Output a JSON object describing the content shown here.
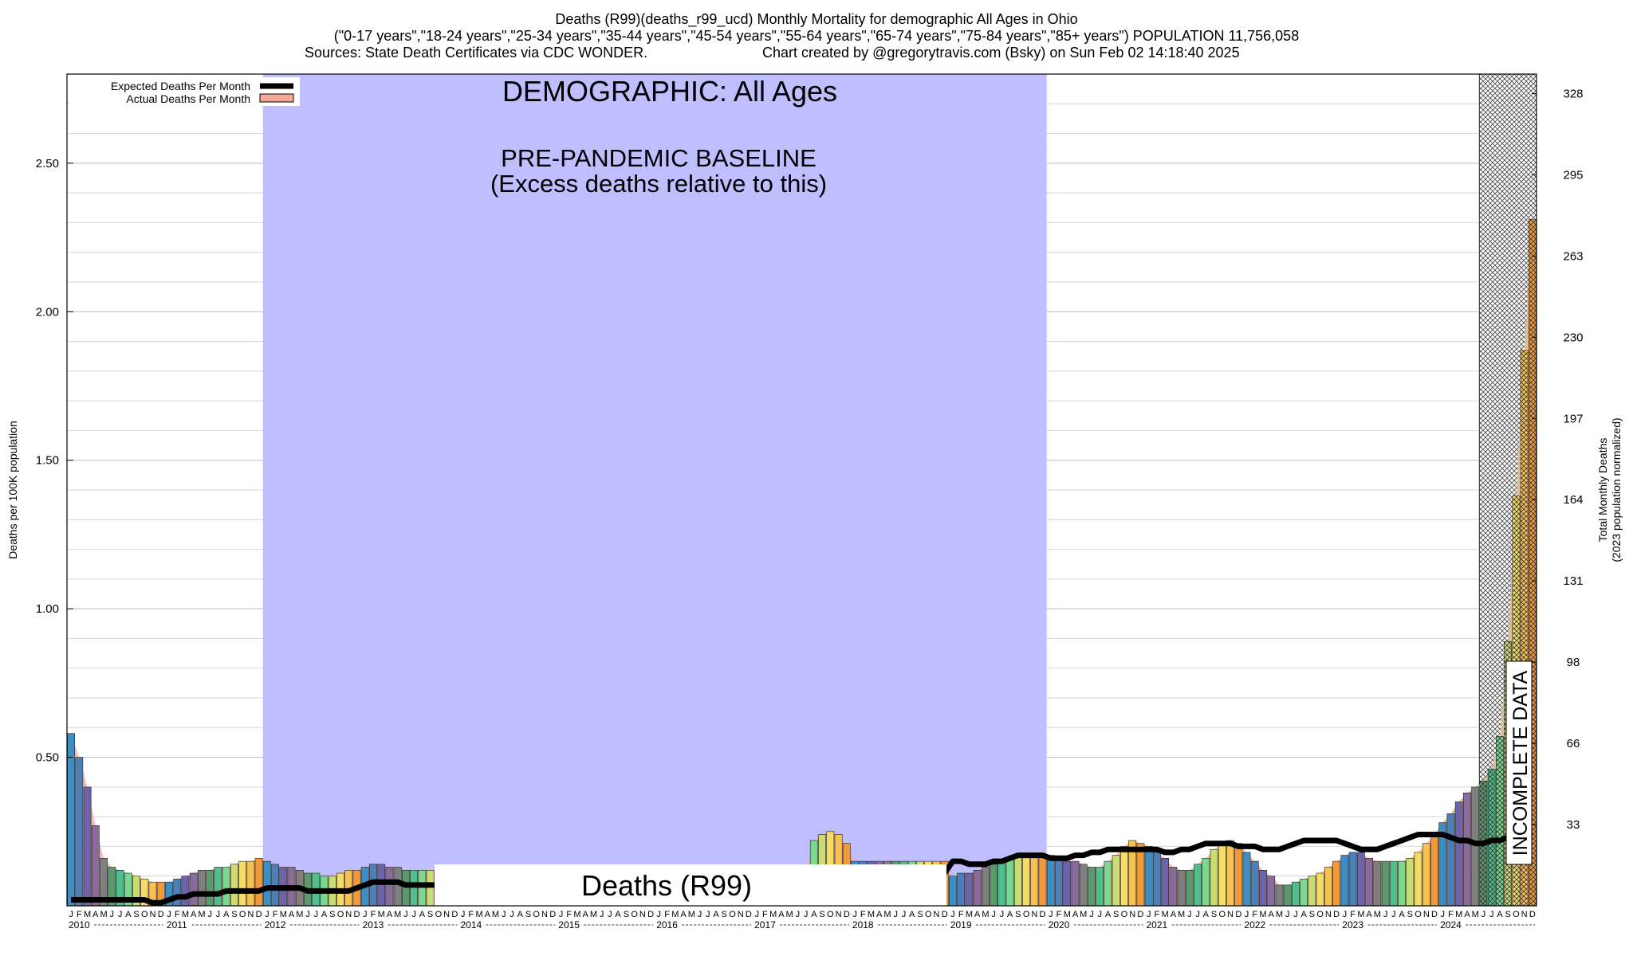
{
  "chart_data": {
    "type": "bar",
    "title_lines": [
      "Deaths (R99)(deaths_r99_ucd) Monthly Mortality for demographic All Ages in Ohio",
      "(\"0-17 years\",\"18-24 years\",\"25-34 years\",\"35-44 years\",\"45-54 years\",\"55-64 years\",\"65-74 years\",\"75-84 years\",\"85+ years\") POPULATION 11,756,058",
      "Sources: State Death Certificates via CDC WONDER.",
      "Chart created by @gregorytravis.com (Bsky) on Sun Feb 02 14:18:40 2025"
    ],
    "ylabel": "Deaths per 100K population",
    "y2label_lines": [
      "Total Monthly Deaths",
      "(2023 population normalized)"
    ],
    "ylim": [
      0,
      2.8
    ],
    "yticks": [
      "0.50",
      "1.00",
      "1.50",
      "2.00",
      "2.50"
    ],
    "y2ticks": [
      "33",
      "66",
      "98",
      "131",
      "164",
      "197",
      "230",
      "263",
      "295",
      "328"
    ],
    "years": [
      "2010",
      "2011",
      "2012",
      "2013",
      "2014",
      "2015",
      "2016",
      "2017",
      "2018",
      "2019",
      "2020",
      "2021",
      "2022",
      "2023",
      "2024"
    ],
    "month_letters": [
      "J",
      "F",
      "M",
      "A",
      "M",
      "J",
      "J",
      "A",
      "S",
      "O",
      "N",
      "D"
    ],
    "legend": [
      {
        "label": "Expected Deaths Per Month",
        "color": "#000000"
      },
      {
        "label": "Actual Deaths Per Month",
        "color": "#f4a99a"
      }
    ],
    "baseline_box": {
      "x_start": "2012-01",
      "x_end": "2019-12",
      "heading": "DEMOGRAPHIC: All Ages",
      "caption_lines": [
        "PRE-PANDEMIC BASELINE",
        "(Excess deaths relative to this)"
      ],
      "color": "#bfbfff"
    },
    "bottom_label": "Deaths (R99)",
    "incomplete": {
      "x_start": "2024-06",
      "label": "INCOMPLETE DATA"
    },
    "series": [
      {
        "name": "Actual Deaths Per Month",
        "values": [
          0.58,
          0.5,
          0.4,
          0.27,
          0.16,
          0.13,
          0.12,
          0.11,
          0.1,
          0.09,
          0.08,
          0.08,
          0.08,
          0.09,
          0.1,
          0.11,
          0.12,
          0.12,
          0.13,
          0.13,
          0.14,
          0.15,
          0.15,
          0.16,
          0.15,
          0.14,
          0.13,
          0.13,
          0.12,
          0.11,
          0.11,
          0.1,
          0.1,
          0.11,
          0.12,
          0.12,
          0.13,
          0.14,
          0.14,
          0.13,
          0.13,
          0.12,
          0.12,
          0.12,
          0.12,
          0.12,
          0.12,
          0.12,
          0.12,
          0.12,
          0.12,
          0.12,
          0.12,
          0.12,
          0.12,
          0.12,
          0.12,
          0.12,
          0.12,
          0.12,
          0.12,
          0.12,
          0.12,
          0.12,
          0.12,
          0.12,
          0.12,
          0.12,
          0.12,
          0.12,
          0.12,
          0.12,
          0.12,
          0.12,
          0.12,
          0.12,
          0.12,
          0.12,
          0.12,
          0.12,
          0.12,
          0.12,
          0.12,
          0.12,
          0.12,
          0.12,
          0.12,
          0.12,
          0.12,
          0.12,
          0.12,
          0.22,
          0.24,
          0.25,
          0.24,
          0.21,
          0.15,
          0.15,
          0.15,
          0.15,
          0.15,
          0.15,
          0.15,
          0.15,
          0.15,
          0.15,
          0.15,
          0.15,
          0.1,
          0.11,
          0.11,
          0.12,
          0.13,
          0.14,
          0.15,
          0.16,
          0.17,
          0.17,
          0.17,
          0.17,
          0.17,
          0.16,
          0.15,
          0.15,
          0.14,
          0.13,
          0.13,
          0.15,
          0.17,
          0.2,
          0.22,
          0.21,
          0.2,
          0.18,
          0.16,
          0.13,
          0.12,
          0.12,
          0.14,
          0.16,
          0.19,
          0.21,
          0.22,
          0.21,
          0.18,
          0.15,
          0.12,
          0.1,
          0.07,
          0.07,
          0.08,
          0.09,
          0.1,
          0.11,
          0.13,
          0.15,
          0.17,
          0.18,
          0.18,
          0.16,
          0.15,
          0.15,
          0.15,
          0.15,
          0.16,
          0.18,
          0.21,
          0.24,
          0.28,
          0.31,
          0.35,
          0.38,
          0.4,
          0.42,
          0.46,
          0.57,
          0.89,
          1.38,
          1.87,
          2.31
        ]
      },
      {
        "name": "Expected Deaths Per Month",
        "values": [
          0.02,
          0.02,
          0.02,
          0.02,
          0.02,
          0.02,
          0.02,
          0.02,
          0.02,
          0.02,
          0.01,
          0.01,
          0.02,
          0.03,
          0.03,
          0.04,
          0.04,
          0.04,
          0.04,
          0.05,
          0.05,
          0.05,
          0.05,
          0.05,
          0.06,
          0.06,
          0.06,
          0.06,
          0.06,
          0.05,
          0.05,
          0.05,
          0.05,
          0.05,
          0.05,
          0.06,
          0.07,
          0.08,
          0.08,
          0.08,
          0.08,
          0.07,
          0.07,
          0.07,
          0.07,
          0.07,
          0.07,
          0.07,
          0.07,
          0.07,
          0.07,
          0.07,
          0.07,
          0.07,
          0.07,
          0.07,
          0.07,
          0.07,
          0.07,
          0.07,
          0.07,
          0.07,
          0.07,
          0.07,
          0.07,
          0.07,
          0.07,
          0.07,
          0.07,
          0.07,
          0.07,
          0.07,
          0.08,
          0.08,
          0.08,
          0.08,
          0.08,
          0.08,
          0.08,
          0.08,
          0.08,
          0.08,
          0.08,
          0.08,
          0.08,
          0.08,
          0.08,
          0.08,
          0.08,
          0.08,
          0.08,
          0.08,
          0.08,
          0.08,
          0.08,
          0.08,
          0.09,
          0.09,
          0.09,
          0.09,
          0.1,
          0.1,
          0.11,
          0.11,
          0.11,
          0.11,
          0.11,
          0.11,
          0.15,
          0.15,
          0.14,
          0.14,
          0.14,
          0.15,
          0.15,
          0.16,
          0.17,
          0.17,
          0.17,
          0.17,
          0.16,
          0.16,
          0.16,
          0.17,
          0.17,
          0.18,
          0.18,
          0.19,
          0.19,
          0.19,
          0.19,
          0.19,
          0.19,
          0.19,
          0.18,
          0.18,
          0.19,
          0.19,
          0.2,
          0.21,
          0.21,
          0.21,
          0.21,
          0.2,
          0.2,
          0.2,
          0.19,
          0.19,
          0.19,
          0.2,
          0.21,
          0.22,
          0.22,
          0.22,
          0.22,
          0.22,
          0.21,
          0.2,
          0.19,
          0.19,
          0.19,
          0.2,
          0.21,
          0.22,
          0.23,
          0.24,
          0.24,
          0.24,
          0.24,
          0.23,
          0.22,
          0.22,
          0.21,
          0.21,
          0.22,
          0.22,
          0.23,
          0.24,
          0.24,
          0.24
        ]
      }
    ]
  }
}
